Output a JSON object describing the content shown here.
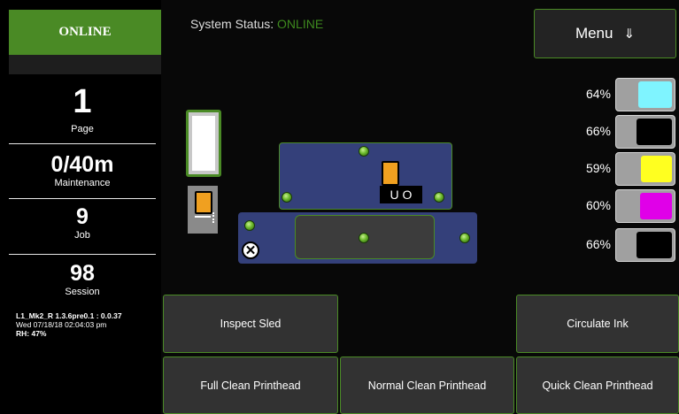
{
  "status_badge": "ONLINE",
  "header": {
    "status_label": "System Status: ",
    "status_value": "ONLINE",
    "menu_label": "Menu",
    "menu_arrow": "⇓"
  },
  "counters": [
    {
      "value": "1",
      "label": "Page"
    },
    {
      "value": "0/40m",
      "label": "Maintenance"
    },
    {
      "value": "9",
      "label": "Job"
    },
    {
      "value": "98",
      "label": "Session"
    }
  ],
  "version": {
    "firmware": "L1_Mk2_R 1.3.6pre0.1 : 0.0.37",
    "datetime": "Wed 07/18/18 02:04:03 pm",
    "humidity": "RH: 47%"
  },
  "inks": [
    {
      "percent": "64%",
      "level": 0.64,
      "color": "#7ff4ff"
    },
    {
      "percent": "66%",
      "level": 0.66,
      "color": "#000000"
    },
    {
      "percent": "59%",
      "level": 0.59,
      "color": "#ffff20"
    },
    {
      "percent": "60%",
      "level": 0.6,
      "color": "#e000e8"
    },
    {
      "percent": "66%",
      "level": 0.66,
      "color": "#000000"
    }
  ],
  "diagram": {
    "nozzle_glyphs": "U O",
    "cap_glyph": "✕"
  },
  "buttons": {
    "inspect_sled": "Inspect Sled",
    "circulate_ink": "Circulate Ink",
    "full_clean": "Full Clean Printhead",
    "normal_clean": "Normal Clean Printhead",
    "quick_clean": "Quick Clean Printhead"
  },
  "colors": {
    "accent": "#4a8a25",
    "sled_blue": "#34407a",
    "cartridge": "#f0a020"
  }
}
